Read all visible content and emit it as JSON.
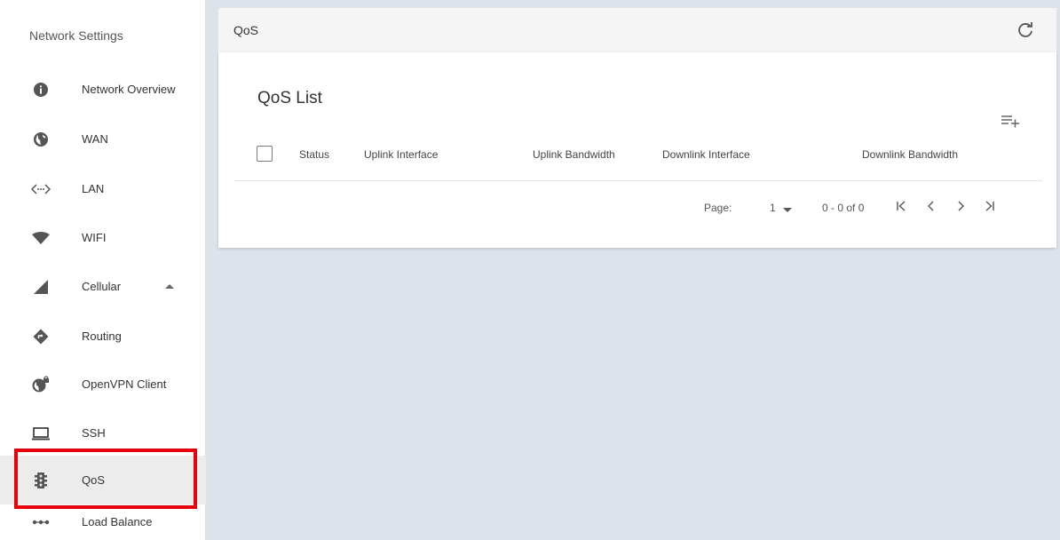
{
  "sidebar": {
    "title": "Network Settings",
    "items": [
      {
        "label": "Network Overview",
        "icon": "info-icon"
      },
      {
        "label": "WAN",
        "icon": "globe-icon"
      },
      {
        "label": "LAN",
        "icon": "lan-icon"
      },
      {
        "label": "WIFI",
        "icon": "wifi-icon"
      },
      {
        "label": "Cellular",
        "icon": "cellular-signal-icon"
      },
      {
        "label": "Routing",
        "icon": "routing-icon"
      },
      {
        "label": "OpenVPN Client",
        "icon": "vpn-globe-lock-icon"
      },
      {
        "label": "SSH",
        "icon": "laptop-icon"
      },
      {
        "label": "QoS",
        "icon": "traffic-light-icon"
      },
      {
        "label": "Load Balance",
        "icon": "load-balance-icon"
      }
    ],
    "active_item": "QoS",
    "highlight_color": "#e8000b"
  },
  "header": {
    "title": "QoS",
    "refresh_icon": "refresh-icon"
  },
  "card": {
    "title": "QoS List",
    "add_icon": "playlist-add-icon",
    "columns": [
      "Status",
      "Uplink Interface",
      "Uplink Bandwidth",
      "Downlink Interface",
      "Downlink Bandwidth"
    ],
    "rows": []
  },
  "pagination": {
    "page_label": "Page:",
    "page_value": "1",
    "range": "0 - 0 of 0"
  }
}
